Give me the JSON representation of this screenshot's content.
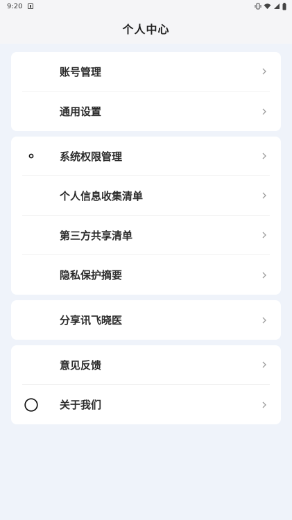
{
  "status_bar": {
    "time": "9:20",
    "icons": [
      "vibrate-icon",
      "wifi-icon",
      "signal-icon",
      "battery-icon"
    ]
  },
  "header": {
    "title": "个人中心"
  },
  "groups": [
    {
      "items": [
        {
          "label": "账号管理",
          "icon": ""
        },
        {
          "label": "通用设置",
          "icon": ""
        }
      ]
    },
    {
      "items": [
        {
          "label": "系统权限管理",
          "icon": "small-ring-icon"
        },
        {
          "label": "个人信息收集清单",
          "icon": ""
        },
        {
          "label": "第三方共享清单",
          "icon": ""
        },
        {
          "label": "隐私保护摘要",
          "icon": ""
        }
      ]
    },
    {
      "items": [
        {
          "label": "分享讯飞晓医",
          "icon": ""
        }
      ]
    },
    {
      "items": [
        {
          "label": "意见反馈",
          "icon": ""
        },
        {
          "label": "关于我们",
          "icon": "circle-icon"
        }
      ]
    }
  ]
}
